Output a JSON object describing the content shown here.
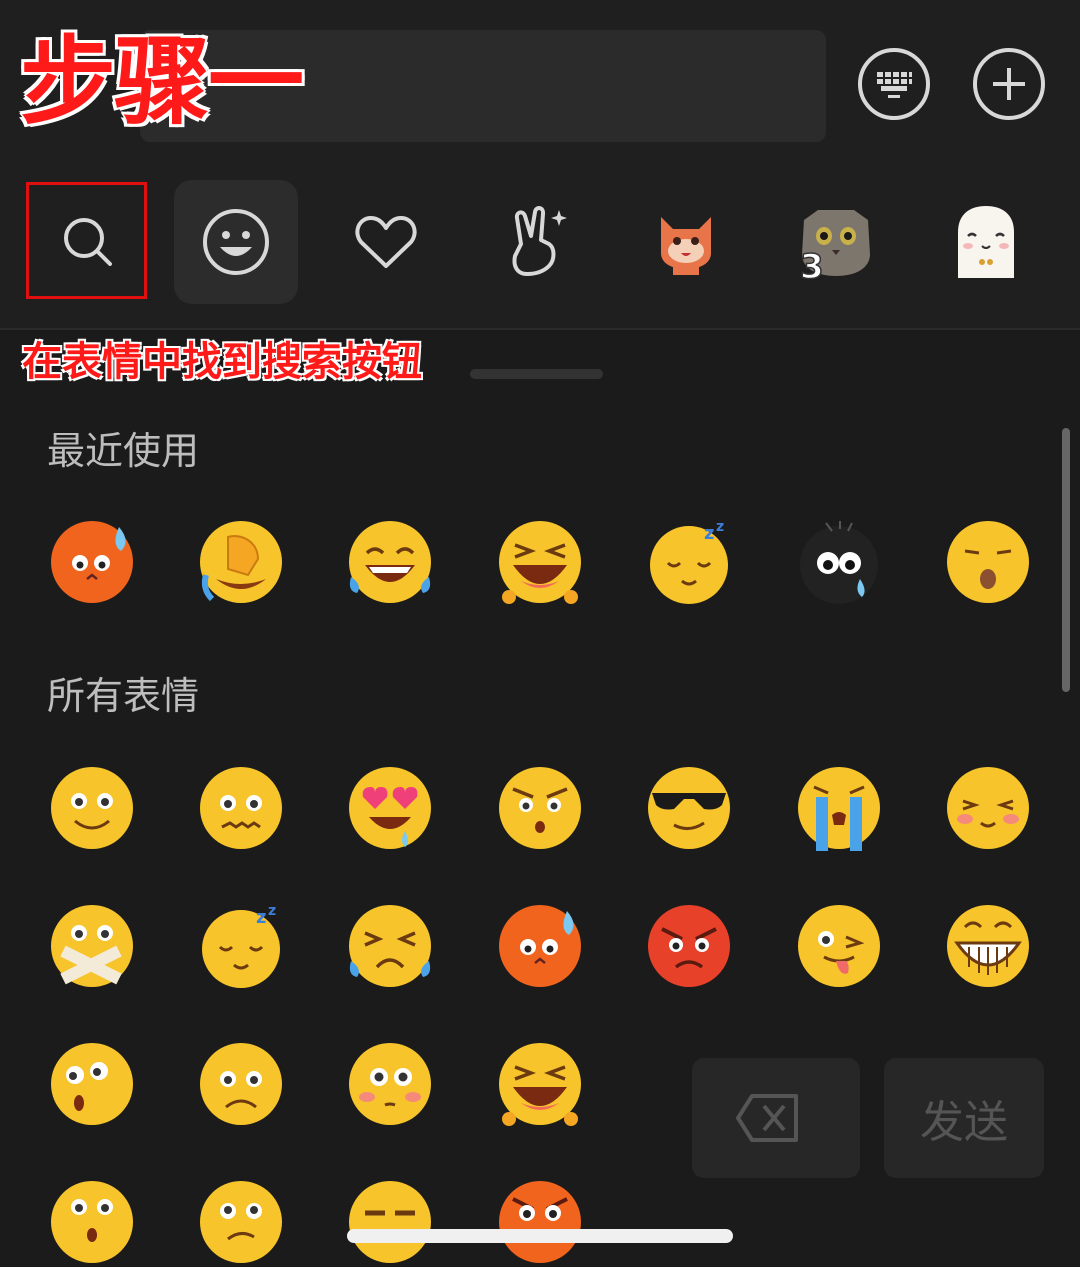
{
  "annotation": {
    "step_title": "步骤一",
    "hint": "在表情中找到搜索按钮"
  },
  "header": {
    "keyboard_icon": "keyboard-icon",
    "plus_icon": "plus-icon"
  },
  "tabs": [
    {
      "name": "search",
      "icon": "search-icon"
    },
    {
      "name": "emoji",
      "icon": "smiley-icon",
      "active": true
    },
    {
      "name": "favorites",
      "icon": "heart-icon"
    },
    {
      "name": "gestures",
      "icon": "victory-hand-icon"
    },
    {
      "name": "sticker-1",
      "icon": "cat-sticker-icon"
    },
    {
      "name": "sticker-2",
      "icon": "gray-cat-sticker-icon",
      "badge": "3"
    },
    {
      "name": "sticker-3",
      "icon": "white-seal-sticker-icon"
    }
  ],
  "sections": {
    "recent": "最近使用",
    "all": "所有表情"
  },
  "actions": {
    "send": "发送",
    "delete_icon": "backspace-icon"
  },
  "colors": {
    "background": "#1b1b1b",
    "annotation_red": "#ff1a1a",
    "emoji_yellow": "#f7c52b"
  }
}
